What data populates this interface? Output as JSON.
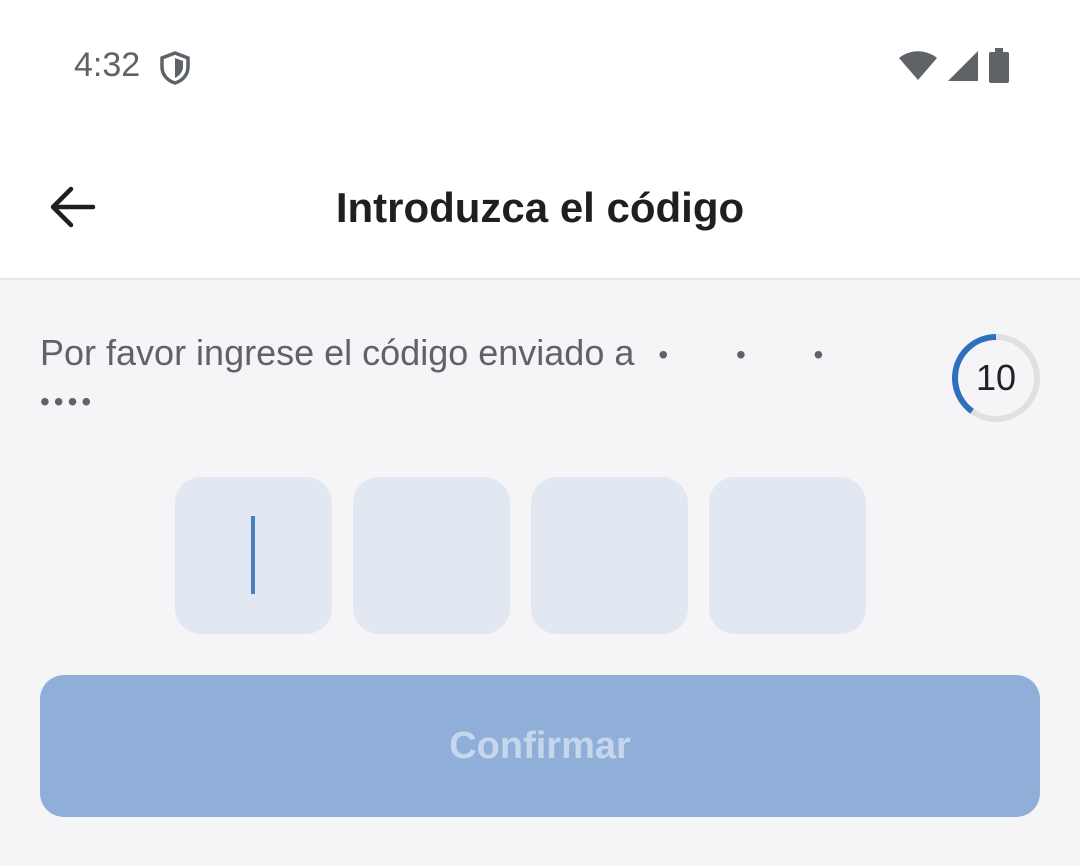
{
  "status_bar": {
    "time": "4:32",
    "icons": [
      "shield-icon",
      "wifi-icon",
      "signal-icon",
      "battery-icon"
    ]
  },
  "app_bar": {
    "title": "Introduzca el código",
    "back_icon": "arrow-left-icon"
  },
  "prompt": {
    "text": "Por favor ingrese el código enviado a",
    "masked_line1": "• • •",
    "masked_line2": "••••"
  },
  "timer": {
    "value": "10",
    "progress_fraction": 0.4,
    "color": "#2f6fc0"
  },
  "otp": {
    "digits": [
      "",
      "",
      "",
      ""
    ],
    "active_index": 0
  },
  "confirm_button": {
    "label": "Confirmar",
    "enabled": false
  },
  "colors": {
    "accent": "#2f6fc0",
    "otp_box": "#e1e8f2",
    "button_disabled": "#90afd8"
  }
}
